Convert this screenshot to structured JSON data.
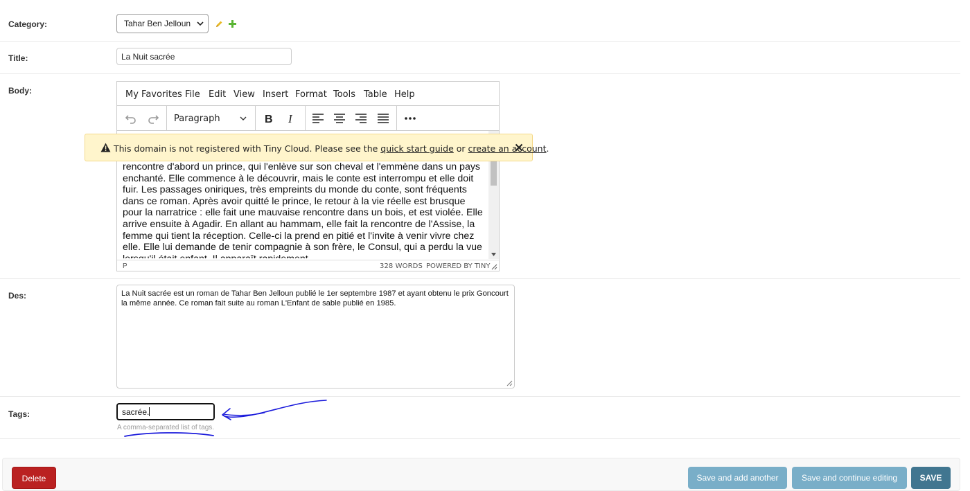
{
  "fields": {
    "category": {
      "label": "Category:",
      "selected": "Tahar Ben Jelloun"
    },
    "title": {
      "label": "Title:",
      "value": "La Nuit sacrée"
    },
    "body": {
      "label": "Body:",
      "menu": [
        "My Favorites",
        "File",
        "Edit",
        "View",
        "Insert",
        "Format",
        "Tools",
        "Table",
        "Help"
      ],
      "block_format": "Paragraph",
      "content": "rencontre d'abord un prince, qui l'enlève sur son cheval et l'emmène dans un pays enchanté. Elle commence à le découvrir, mais le conte est interrompu et elle doit fuir. Les passages oniriques, très empreints du monde du conte, sont fréquents dans ce roman. Après avoir quitté le prince, le retour à la vie réelle est brusque pour la narratrice : elle fait une mauvaise rencontre dans un bois, et est violée. Elle arrive ensuite à Agadir. En allant au hammam, elle fait la rencontre de l'Assise, la femme qui tient la réception. Celle-ci la prend en pitié et l'invite à venir vivre chez elle. Elle lui demande de tenir compagnie à son frère, le Consul, qui a perdu la vue lorsqu'il était enfant. Il apparaît rapidement",
      "status_path": "P",
      "word_count": "328 WORDS",
      "powered_by": "POWERED BY TINY"
    },
    "des": {
      "label": "Des:",
      "value": "La Nuit sacrée est un roman de Tahar Ben Jelloun publié le 1er septembre 1987 et ayant obtenu le prix Goncourt la même année. Ce roman fait suite au roman L'Enfant de sable publié en 1985."
    },
    "tags": {
      "label": "Tags:",
      "value": "sacrée.",
      "help": "A comma-separated list of tags."
    }
  },
  "notice": {
    "text_before": "This domain is not registered with Tiny Cloud. Please see the ",
    "link1": "quick start guide",
    "text_mid": " or ",
    "link2": "create an account",
    "text_after": "."
  },
  "buttons": {
    "delete": "Delete",
    "save_add_another": "Save and add another",
    "save_continue": "Save and continue editing",
    "save": "SAVE"
  },
  "colors": {
    "delete": "#ba2121",
    "secondary": "#79aec8",
    "primary": "#417690",
    "notice_bg": "#fff5cc",
    "annotation": "#1a1adb"
  }
}
